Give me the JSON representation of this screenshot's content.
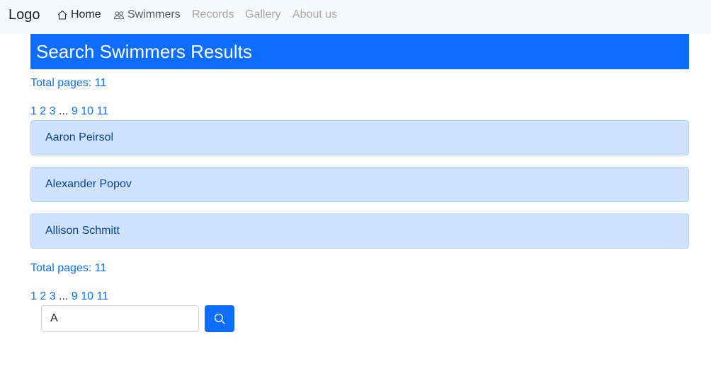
{
  "navbar": {
    "brand": "Logo",
    "items": [
      {
        "label": "Home",
        "icon": "home-icon"
      },
      {
        "label": "Swimmers",
        "icon": "people-icon"
      },
      {
        "label": "Records"
      },
      {
        "label": "Gallery"
      },
      {
        "label": "About us"
      }
    ]
  },
  "banner": {
    "title": "Search Swimmers Results"
  },
  "pagination_top": {
    "total_label": "Total pages: 11",
    "pages": [
      "1",
      "2",
      "3",
      "...",
      "9",
      "10",
      "11"
    ]
  },
  "results": [
    {
      "name": "Aaron Peirsol"
    },
    {
      "name": "Alexander Popov"
    },
    {
      "name": "Allison Schmitt"
    }
  ],
  "pagination_bottom": {
    "total_label": "Total pages: 11",
    "pages": [
      "1",
      "2",
      "3",
      "...",
      "9",
      "10",
      "11"
    ]
  },
  "search": {
    "value": "A",
    "button_icon": "search-icon"
  },
  "colors": {
    "primary": "#0d6efd",
    "card_bg": "#cfe2ff",
    "card_text": "#084298"
  }
}
